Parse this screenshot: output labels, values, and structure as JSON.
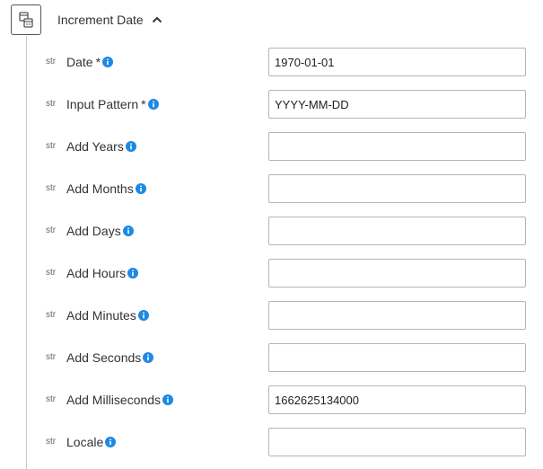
{
  "node": {
    "title": "Increment Date",
    "icon": "date-operations-icon",
    "toggle_icon": "chevron-up-icon"
  },
  "colors": {
    "info_icon": "#1e88e5",
    "input_border": "#b5b5b5",
    "tree_line": "#c8c8c8"
  },
  "params": [
    {
      "type": "str",
      "label": "Date",
      "required": true,
      "value": "1970-01-01"
    },
    {
      "type": "str",
      "label": "Input Pattern",
      "required": true,
      "value": "YYYY-MM-DD"
    },
    {
      "type": "str",
      "label": "Add Years",
      "required": false,
      "value": ""
    },
    {
      "type": "str",
      "label": "Add Months",
      "required": false,
      "value": ""
    },
    {
      "type": "str",
      "label": "Add Days",
      "required": false,
      "value": ""
    },
    {
      "type": "str",
      "label": "Add Hours",
      "required": false,
      "value": ""
    },
    {
      "type": "str",
      "label": "Add Minutes",
      "required": false,
      "value": ""
    },
    {
      "type": "str",
      "label": "Add Seconds",
      "required": false,
      "value": ""
    },
    {
      "type": "str",
      "label": "Add Milliseconds",
      "required": false,
      "value": "1662625134000"
    },
    {
      "type": "str",
      "label": "Locale",
      "required": false,
      "value": ""
    }
  ]
}
